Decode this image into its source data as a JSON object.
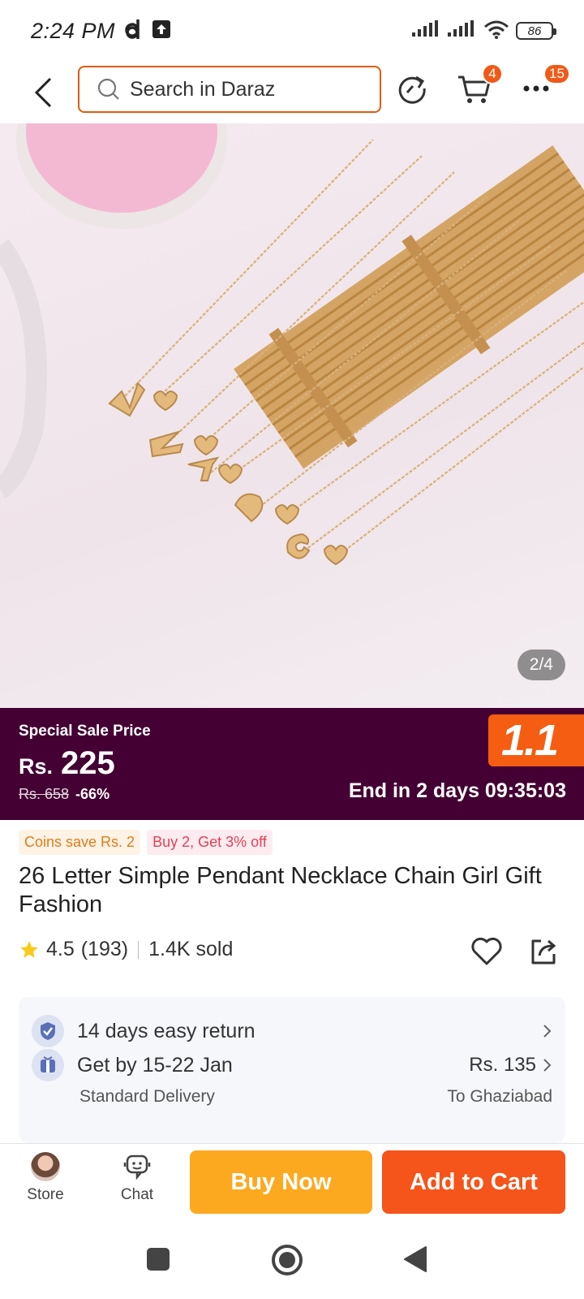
{
  "status_bar": {
    "time": "2:24 PM",
    "battery": "86"
  },
  "header": {
    "search_placeholder": "Search in Daraz",
    "cart_badge": "4",
    "more_badge": "15"
  },
  "gallery": {
    "counter": "2/4"
  },
  "sale": {
    "label": "Special Sale Price",
    "currency": "Rs.",
    "price": "225",
    "original_price": "Rs. 658",
    "discount": "-66%",
    "promo_logo": "1.1",
    "end_text": "End in 2 days 09:35:03"
  },
  "tags": {
    "coins": "Coins save Rs. 2",
    "buy_more": "Buy 2, Get 3% off"
  },
  "product": {
    "title": "26 Letter Simple Pendant Necklace Chain Girl Gift Fashion",
    "rating": "4.5",
    "reviews": "(193)",
    "sold": "1.4K sold"
  },
  "services": {
    "return_text": "14 days easy return",
    "delivery_text": "Get by 15-22 Jan",
    "delivery_type": "Standard Delivery",
    "delivery_price": "Rs. 135",
    "delivery_to": "To Ghaziabad"
  },
  "bottom_bar": {
    "store_label": "Store",
    "chat_label": "Chat",
    "buy_now": "Buy Now",
    "add_to_cart": "Add to Cart"
  },
  "colors": {
    "accent_orange": "#f5541a",
    "buy_now_yellow": "#fda920",
    "banner_purple": "#440033"
  }
}
